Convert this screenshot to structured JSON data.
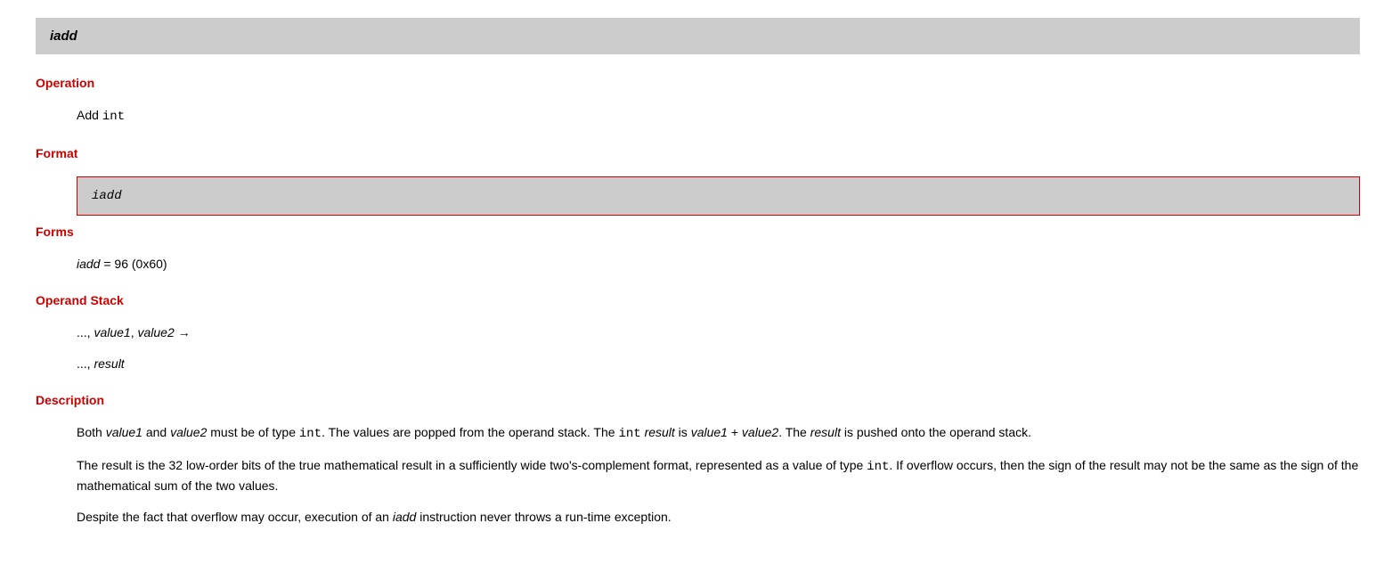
{
  "title": "iadd",
  "sections": {
    "operation": {
      "heading": "Operation",
      "text_prefix": "Add ",
      "text_code": "int"
    },
    "format": {
      "heading": "Format",
      "box": "iadd"
    },
    "forms": {
      "heading": "Forms",
      "instr": "iadd",
      "suffix": " = 96 (0x60)"
    },
    "operand_stack": {
      "heading": "Operand Stack",
      "line1_prefix": "..., ",
      "line1_v1": "value1",
      "line1_sep": ", ",
      "line1_v2": "value2",
      "line1_arrow": " →",
      "line2_prefix": "..., ",
      "line2_result": "result"
    },
    "description": {
      "heading": "Description",
      "p1": {
        "t1": "Both ",
        "v1": "value1",
        "t2": " and ",
        "v2": "value2",
        "t3": " must be of type ",
        "c1": "int",
        "t4": ". The values are popped from the operand stack. The ",
        "c2": "int",
        "t5": " ",
        "r1": "result",
        "t6": " is ",
        "v1b": "value1",
        "t7": " + ",
        "v2b": "value2",
        "t8": ". The ",
        "r2": "result",
        "t9": " is pushed onto the operand stack."
      },
      "p2": {
        "t1": "The result is the 32 low-order bits of the true mathematical result in a sufficiently wide two's-complement format, represented as a value of type ",
        "c1": "int",
        "t2": ". If overflow occurs, then the sign of the result may not be the same as the sign of the mathematical sum of the two values."
      },
      "p3": {
        "t1": "Despite the fact that overflow may occur, execution of an ",
        "i1": "iadd",
        "t2": " instruction never throws a run-time exception."
      }
    }
  }
}
